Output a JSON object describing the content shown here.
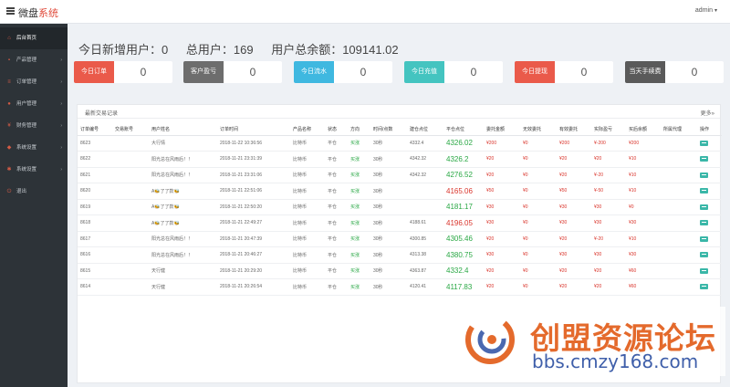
{
  "app": {
    "brand_main": "微盘",
    "brand_accent": "系统",
    "admin_label": "admin"
  },
  "colors": {
    "accent": "#e04b3b",
    "sidebar_bg": "#2d3338",
    "up": "#d9342b",
    "down": "#2aa845"
  },
  "sidebar": {
    "items": [
      {
        "label": "后台首页",
        "icon": "home-icon",
        "active": true
      },
      {
        "label": "产品管理",
        "icon": "box-icon",
        "arrow": "›"
      },
      {
        "label": "订单管理",
        "icon": "list-icon",
        "arrow": "›"
      },
      {
        "label": "用户管理",
        "icon": "user-icon",
        "arrow": "›"
      },
      {
        "label": "财务管理",
        "icon": "finance-icon",
        "arrow": "›"
      },
      {
        "label": "系统设置",
        "icon": "settings-icon",
        "arrow": "›"
      },
      {
        "label": "系统设置",
        "icon": "gear-icon",
        "arrow": "›"
      },
      {
        "label": "退出",
        "icon": "logout-icon"
      }
    ]
  },
  "stats": {
    "new_users": "今日新增用户：0",
    "total_users": "总用户：169",
    "total_balance": "用户总余额：109141.02"
  },
  "cards": [
    {
      "label": "今日订单",
      "value": "0",
      "color": "#ea5a4a"
    },
    {
      "label": "客户盈亏",
      "value": "0",
      "color": "#6d6d6d"
    },
    {
      "label": "今日流水",
      "value": "0",
      "color": "#3fb8e0"
    },
    {
      "label": "今日充值",
      "value": "0",
      "color": "#44c4c0"
    },
    {
      "label": "今日提现",
      "value": "0",
      "color": "#ea5a4a"
    },
    {
      "label": "当天手续费",
      "value": "0",
      "color": "#5a5a5a"
    }
  ],
  "panel": {
    "title": "最新交易记录",
    "more": "更多»"
  },
  "table": {
    "headers": [
      "订单编号",
      "交易账号",
      "用户姓名",
      "订单时间",
      "产品名称",
      "状态",
      "方向",
      "时间/点数",
      "建仓点位",
      "平仓点位",
      "委托金额",
      "无效委托",
      "有效委托",
      "实际盈亏",
      "买后余额",
      "所属代理",
      "操作"
    ],
    "rows": [
      [
        "8623",
        "",
        "大行情",
        "2018-11-22 10:36:56",
        "比特币",
        "平仓",
        "买涨",
        "30秒",
        "4332.4",
        "4326.02",
        "¥200",
        "¥0",
        "¥200",
        "¥-200",
        "¥200",
        "",
        ""
      ],
      [
        "8622",
        "",
        "阳光总在风雨后！！",
        "2018-11-21 23:31:39",
        "比特币",
        "平仓",
        "买涨",
        "30秒",
        "4342.32",
        "4326.2",
        "¥20",
        "¥0",
        "¥20",
        "¥20",
        "¥10",
        "",
        ""
      ],
      [
        "8621",
        "",
        "阳光总在风雨后！！",
        "2018-11-21 23:31:06",
        "比特币",
        "平仓",
        "买涨",
        "30秒",
        "4342.32",
        "4276.52",
        "¥20",
        "¥0",
        "¥20",
        "¥-20",
        "¥10",
        "",
        ""
      ],
      [
        "8620",
        "",
        "A🐝了了款🐝",
        "2018-11-21 22:51:06",
        "比特币",
        "平仓",
        "买涨",
        "30秒",
        "",
        "4165.06",
        "¥50",
        "¥0",
        "¥50",
        "¥-50",
        "¥10",
        "",
        ""
      ],
      [
        "8619",
        "",
        "A🐝了了款🐝",
        "2018-11-21 22:50:20",
        "比特币",
        "平仓",
        "买涨",
        "30秒",
        "",
        "4181.17",
        "¥30",
        "¥0",
        "¥30",
        "¥30",
        "¥0",
        "",
        ""
      ],
      [
        "8618",
        "",
        "A🐝了了款🐝",
        "2018-11-21 22:49:27",
        "比特币",
        "平仓",
        "买涨",
        "30秒",
        "4188.61",
        "4196.05",
        "¥30",
        "¥0",
        "¥30",
        "¥30",
        "¥30",
        "",
        ""
      ],
      [
        "8617",
        "",
        "阳光总在风雨后！！",
        "2018-11-21 20:47:39",
        "比特币",
        "平仓",
        "买涨",
        "30秒",
        "4300.85",
        "4305.46",
        "¥20",
        "¥0",
        "¥20",
        "¥-20",
        "¥10",
        "",
        ""
      ],
      [
        "8616",
        "",
        "阳光总在风雨后！！",
        "2018-11-21 20:46:27",
        "比特币",
        "平仓",
        "买涨",
        "30秒",
        "4313.38",
        "4380.75",
        "¥30",
        "¥0",
        "¥30",
        "¥30",
        "¥30",
        "",
        ""
      ],
      [
        "8615",
        "",
        "天行健",
        "2018-11-21 20:29:20",
        "比特币",
        "平仓",
        "买涨",
        "30秒",
        "4363.87",
        "4332.4",
        "¥20",
        "¥0",
        "¥20",
        "¥20",
        "¥60",
        "",
        ""
      ],
      [
        "8614",
        "",
        "天行健",
        "2018-11-21 20:26:54",
        "比特币",
        "平仓",
        "买涨",
        "30秒",
        "4120.41",
        "4117.83",
        "¥20",
        "¥0",
        "¥20",
        "¥20",
        "¥60",
        "",
        ""
      ]
    ],
    "price_color": [
      "down",
      "down",
      "down",
      "up",
      "down",
      "up",
      "down",
      "down",
      "down",
      "down"
    ]
  },
  "watermark": {
    "title": "创盟资源论坛",
    "url": "bbs.cmzy168.com"
  }
}
